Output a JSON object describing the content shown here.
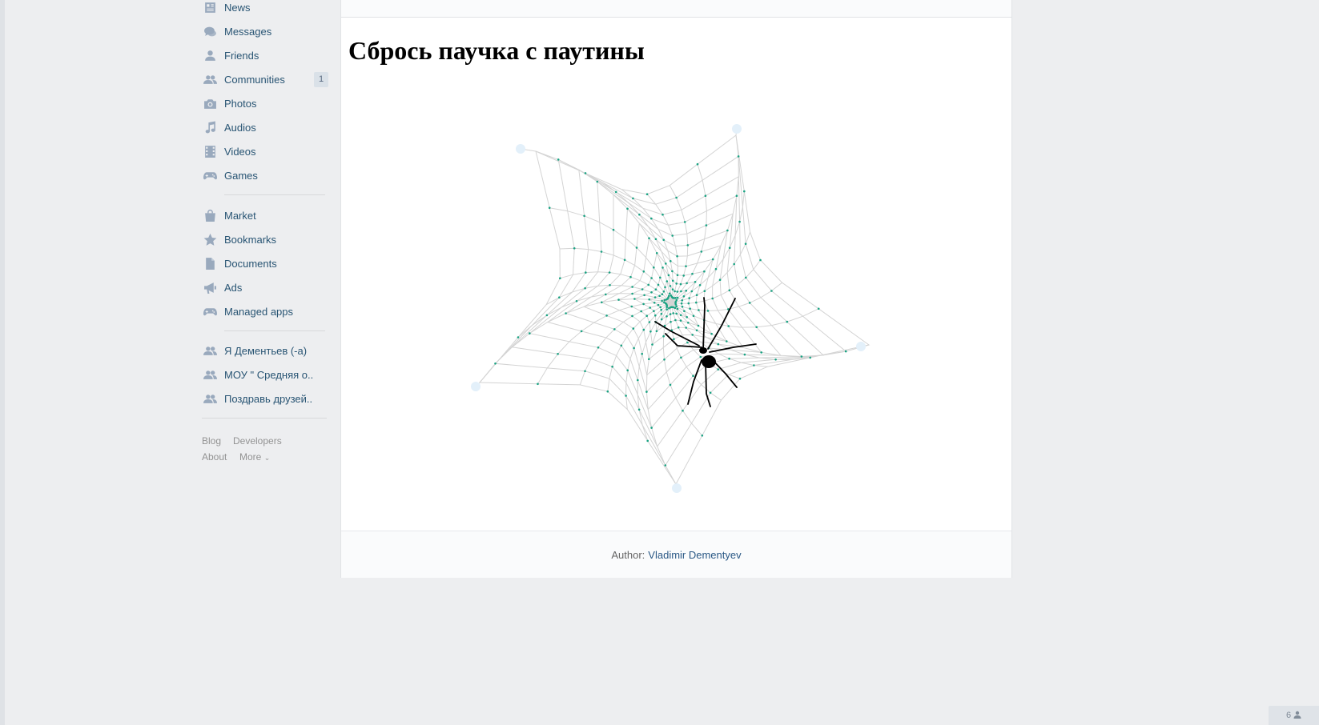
{
  "sidebar": {
    "items": [
      {
        "id": "news",
        "label": "News",
        "icon": "news-icon"
      },
      {
        "id": "messages",
        "label": "Messages",
        "icon": "messages-icon"
      },
      {
        "id": "friends",
        "label": "Friends",
        "icon": "friends-icon"
      },
      {
        "id": "communities",
        "label": "Communities",
        "icon": "communities-icon",
        "badge": "1"
      },
      {
        "id": "photos",
        "label": "Photos",
        "icon": "camera-icon"
      },
      {
        "id": "audios",
        "label": "Audios",
        "icon": "music-note-icon"
      },
      {
        "id": "videos",
        "label": "Videos",
        "icon": "film-icon"
      },
      {
        "id": "games",
        "label": "Games",
        "icon": "gamepad-icon"
      },
      {
        "id": "market",
        "label": "Market",
        "icon": "shopping-bag-icon"
      },
      {
        "id": "bookmarks",
        "label": "Bookmarks",
        "icon": "star-icon"
      },
      {
        "id": "documents",
        "label": "Documents",
        "icon": "document-icon"
      },
      {
        "id": "ads",
        "label": "Ads",
        "icon": "megaphone-icon"
      },
      {
        "id": "managed-apps",
        "label": "Managed apps",
        "icon": "gamepad-icon"
      },
      {
        "id": "group-1",
        "label": "Я Дементьев (-а)",
        "icon": "group-icon"
      },
      {
        "id": "group-2",
        "label": "МОУ \" Средняя о..",
        "icon": "group-icon"
      },
      {
        "id": "group-3",
        "label": "Поздравь друзей..",
        "icon": "group-icon"
      }
    ],
    "footer": {
      "blog": "Blog",
      "developers": "Developers",
      "about": "About",
      "more": "More"
    }
  },
  "app": {
    "title": "Сбрось паучка с паутины",
    "author_prefix": "Author:",
    "author_name": "Vladimir Dementyev"
  },
  "game": {
    "web_color": "#d4d4d4",
    "knot_color": "#1aa383",
    "spider_color": "#000000",
    "anchor_color": "#e3f0fa",
    "rings": 12,
    "spokes": 30
  },
  "online_widget": {
    "count": "6"
  },
  "colors": {
    "background": "#edeef0",
    "link": "#2a5885",
    "sidebar_icon": "#99a9bd"
  }
}
